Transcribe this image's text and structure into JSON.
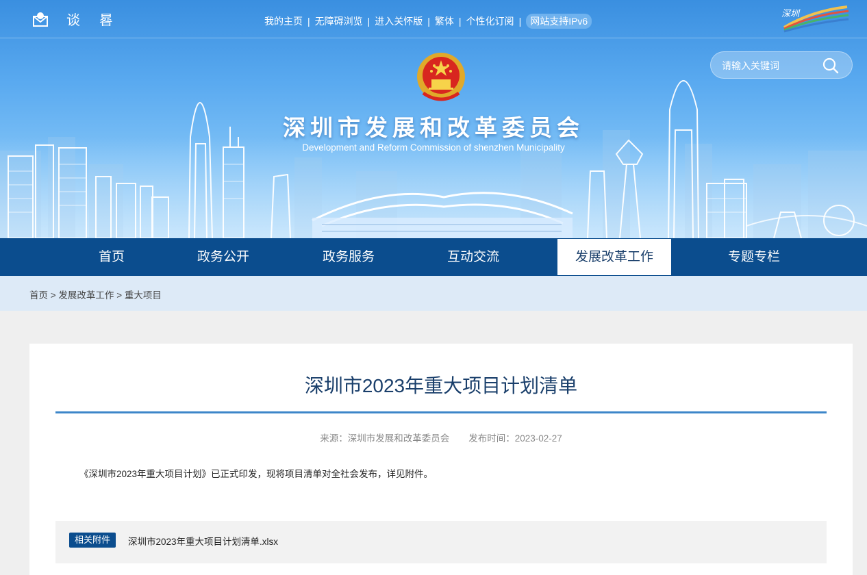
{
  "header": {
    "top_icons": [
      "mail-icon",
      "elder-care-icon",
      "accessibility-icon"
    ],
    "top_links": [
      "我的主页",
      "无障碍浏览",
      "进入关怀版",
      "繁体",
      "个性化订阅"
    ],
    "separator": "|",
    "ipv6_badge": "网站支持IPv6",
    "city_logo_alt": "深圳 SHENZHEN CHINA",
    "search": {
      "placeholder": "请输入关键词"
    },
    "title": "深圳市发展和改革委员会",
    "subtitle": "Development and Reform Commission of shenzhen Municipality"
  },
  "nav": {
    "items": [
      {
        "label": "首页",
        "active": false
      },
      {
        "label": "政务公开",
        "active": false
      },
      {
        "label": "政务服务",
        "active": false
      },
      {
        "label": "互动交流",
        "active": false
      },
      {
        "label": "发展改革工作",
        "active": true
      },
      {
        "label": "专题专栏",
        "active": false
      }
    ]
  },
  "breadcrumb": {
    "items": [
      "首页",
      "发展改革工作",
      "重大项目"
    ],
    "separator": ">"
  },
  "article": {
    "title": "深圳市2023年重大项目计划清单",
    "source_label": "来源：",
    "source": "深圳市发展和改革委员会",
    "date_label": "发布时间：",
    "date": "2023-02-27",
    "body": "《深圳市2023年重大项目计划》已正式印发，现将项目清单对全社会发布，详见附件。",
    "attachment_label": "相关附件",
    "attachment_file": "深圳市2023年重大项目计划清单.xlsx"
  },
  "colors": {
    "nav_bg": "#0b4d8e",
    "title_blue": "#1a3f6b",
    "rule_blue": "#3d86c9",
    "crumb_bg": "#ddeaf7",
    "page_bg": "#efefef"
  }
}
